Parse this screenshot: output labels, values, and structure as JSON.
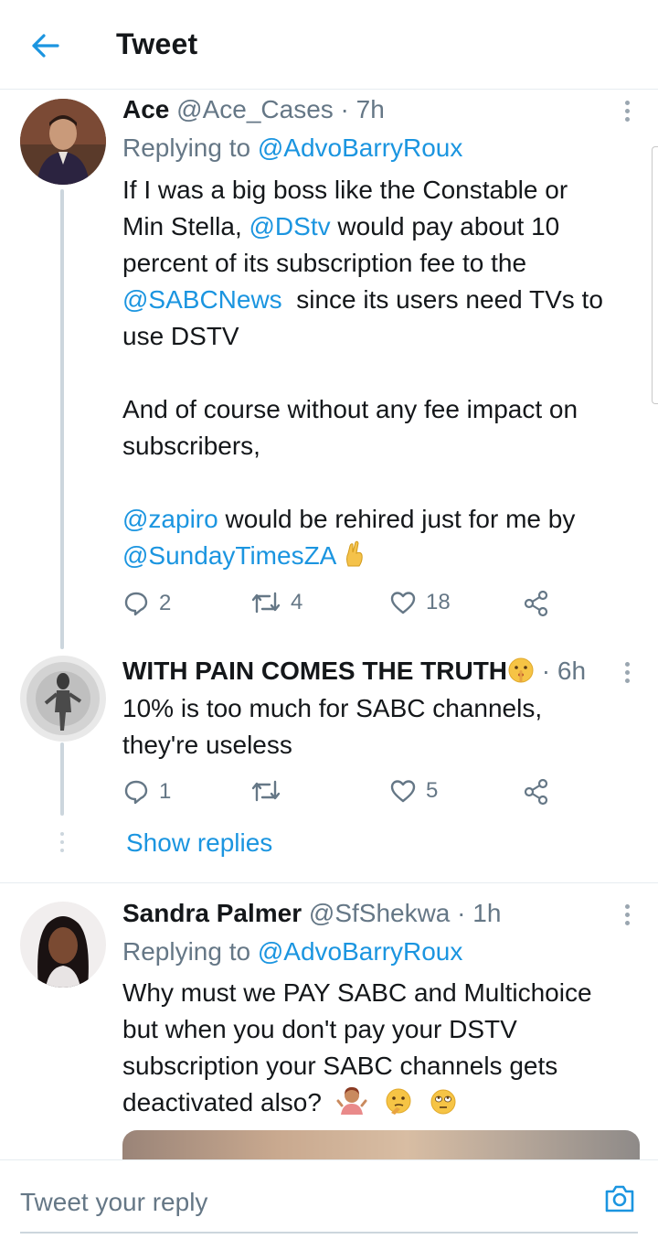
{
  "header": {
    "title": "Tweet",
    "back_icon": "arrow-left-icon"
  },
  "colors": {
    "accent": "#1b95e0",
    "muted": "#657786",
    "text": "#14171a",
    "divider": "#e6ecf0"
  },
  "tweets": [
    {
      "name": "Ace",
      "handle": "@Ace_Cases",
      "time": "7h",
      "replying_prefix": "Replying to",
      "replying_to": "@AdvoBarryRoux",
      "lines": [
        "If I was a big boss like the Constable or",
        "Min Stella, ",
        "@DStv",
        " would pay about 10",
        "percent of its subscription fee to the",
        "@SABCNews",
        "  since its users need TVs to",
        "use DSTV",
        "And of course without any fee impact on",
        "subscribers,",
        "@zapiro",
        " would be rehired just for me by",
        "@SundayTimesZA"
      ],
      "replies": "2",
      "retweets": "4",
      "likes": "18"
    },
    {
      "name": "WITH PAIN COMES THE TRUTH",
      "time": "6h",
      "lines": [
        "10% is too much for SABC channels,",
        "they're useless"
      ],
      "replies": "1",
      "retweets": "",
      "likes": "5"
    },
    {
      "name": "Sandra Palmer",
      "handle": "@SfShekwa",
      "time": "1h",
      "replying_prefix": "Replying to",
      "replying_to": "@AdvoBarryRoux",
      "lines": [
        "Why must we PAY SABC and Multichoice",
        "but when you don't pay your DSTV",
        "subscription your SABC channels gets",
        "deactivated also?"
      ]
    }
  ],
  "show_replies": "Show replies",
  "reply_bar": {
    "placeholder": "Tweet your reply",
    "camera_icon": "camera-icon"
  }
}
